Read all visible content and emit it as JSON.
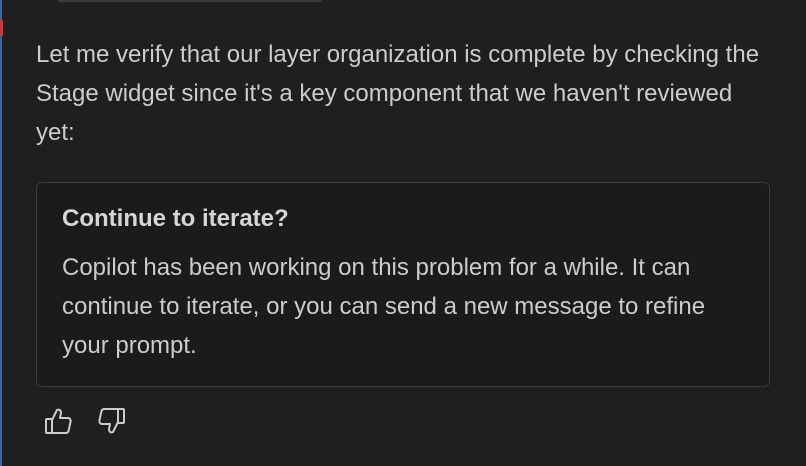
{
  "message": {
    "text": "Let me verify that our layer organization is complete by checking the Stage widget since it's a key component that we haven't reviewed yet:"
  },
  "confirmation": {
    "title": "Continue to iterate?",
    "body": "Copilot has been working on this problem for a while. It can continue to iterate, or you can send a new message to refine your prompt."
  },
  "feedback": {
    "icons": [
      "thumbs-up-icon",
      "thumbs-down-icon"
    ]
  },
  "colors": {
    "background": "#1f1f1f",
    "text": "#cccccc",
    "card_border": "#3c3c3c",
    "accent": "#2b6cb0"
  }
}
